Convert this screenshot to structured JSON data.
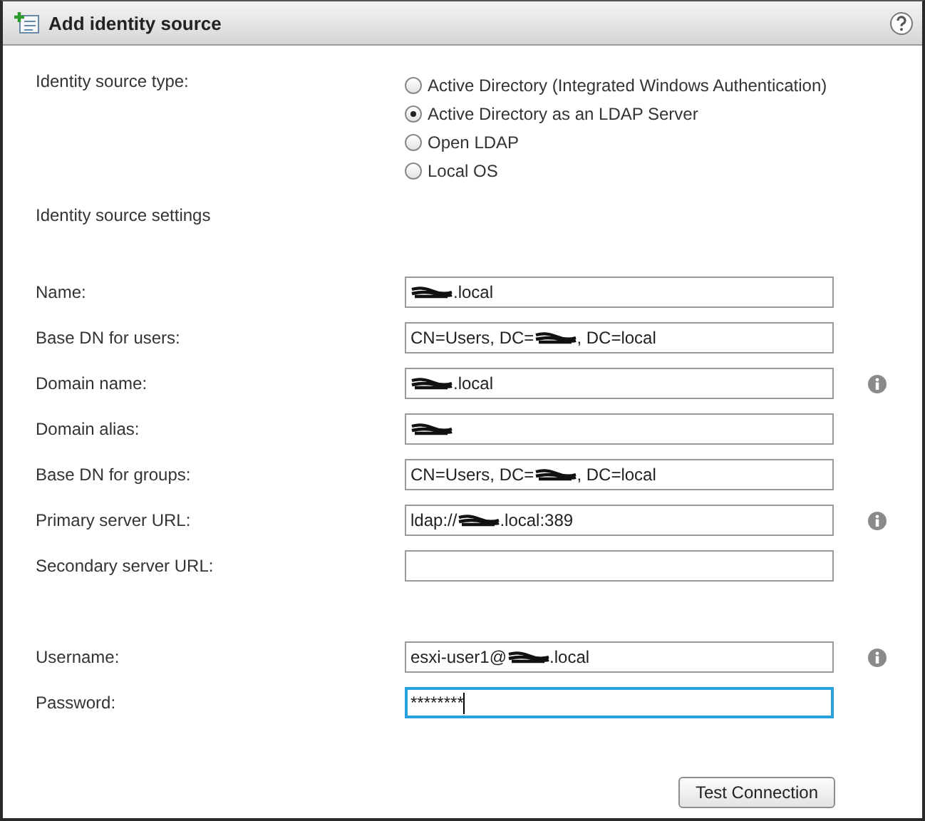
{
  "window": {
    "title": "Add identity source"
  },
  "source_type": {
    "label": "Identity source type:",
    "options": [
      {
        "label": "Active Directory (Integrated Windows Authentication)",
        "selected": false
      },
      {
        "label": "Active Directory as an LDAP Server",
        "selected": true
      },
      {
        "label": "Open LDAP",
        "selected": false
      },
      {
        "label": "Local OS",
        "selected": false
      }
    ]
  },
  "settings_heading": "Identity source settings",
  "fields": [
    {
      "label": "Name:",
      "parts": [
        {
          "kind": "redacted"
        },
        {
          "kind": "text",
          "text": ".local"
        }
      ],
      "info": false,
      "focused": false
    },
    {
      "label": "Base DN for users:",
      "parts": [
        {
          "kind": "text",
          "text": "CN=Users, DC="
        },
        {
          "kind": "redacted"
        },
        {
          "kind": "text",
          "text": ", DC=local"
        }
      ],
      "info": false,
      "focused": false
    },
    {
      "label": "Domain name:",
      "parts": [
        {
          "kind": "redacted"
        },
        {
          "kind": "text",
          "text": ".local"
        }
      ],
      "info": true,
      "focused": false
    },
    {
      "label": "Domain alias:",
      "parts": [
        {
          "kind": "redacted"
        }
      ],
      "info": false,
      "focused": false
    },
    {
      "label": "Base DN for groups:",
      "parts": [
        {
          "kind": "text",
          "text": "CN=Users, DC="
        },
        {
          "kind": "redacted"
        },
        {
          "kind": "text",
          "text": ", DC=local"
        }
      ],
      "info": false,
      "focused": false
    },
    {
      "label": "Primary server URL:",
      "parts": [
        {
          "kind": "text",
          "text": "ldap://"
        },
        {
          "kind": "redacted"
        },
        {
          "kind": "text",
          "text": ".local:389"
        }
      ],
      "info": true,
      "focused": false
    },
    {
      "label": "Secondary server URL:",
      "info": false,
      "focused": false
    },
    {
      "kind": "gap"
    },
    {
      "label": "Username:",
      "parts": [
        {
          "kind": "text",
          "text": "esxi-user1@"
        },
        {
          "kind": "redacted"
        },
        {
          "kind": "text",
          "text": ".local"
        }
      ],
      "info": true,
      "focused": false
    },
    {
      "label": "Password:",
      "parts": [
        {
          "kind": "text",
          "text": "********"
        }
      ],
      "info": false,
      "focused": true
    }
  ],
  "buttons": [
    "Test Connection"
  ]
}
